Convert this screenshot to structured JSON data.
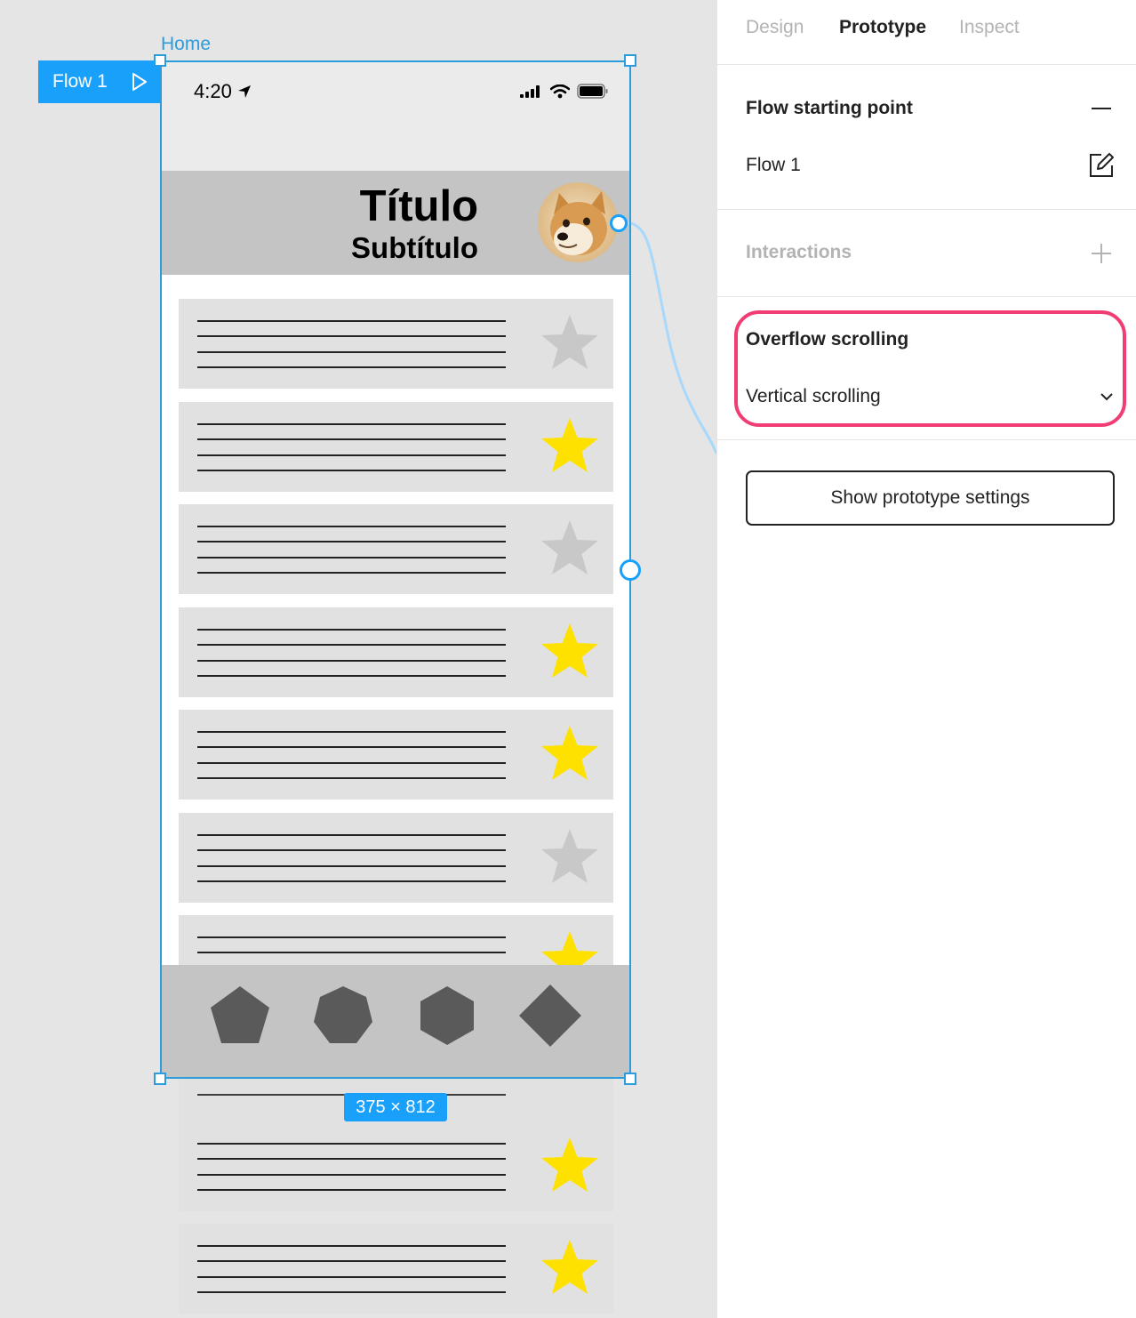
{
  "canvas": {
    "frame_name": "Home",
    "flow_tag_label": "Flow 1",
    "size_badge": "375 × 812",
    "phone": {
      "status_time": "4:20",
      "title": "Título",
      "subtitle": "Subtítulo",
      "cards": [
        {
          "starred": false
        },
        {
          "starred": true
        },
        {
          "starred": false
        },
        {
          "starred": true
        },
        {
          "starred": true
        },
        {
          "starred": false
        },
        {
          "starred": true
        }
      ],
      "overflow_cards": [
        {
          "starred": true
        },
        {
          "starred": true
        }
      ],
      "tabs": [
        "pentagon-icon",
        "heptagon-icon",
        "hexagon-icon",
        "diamond-icon"
      ]
    }
  },
  "panel": {
    "tabs": [
      {
        "label": "Design",
        "active": false
      },
      {
        "label": "Prototype",
        "active": true
      },
      {
        "label": "Inspect",
        "active": false
      }
    ],
    "flow_section": {
      "title": "Flow starting point",
      "flow_name": "Flow 1"
    },
    "interactions": {
      "title": "Interactions"
    },
    "overflow": {
      "title": "Overflow scrolling",
      "value": "Vertical scrolling"
    },
    "settings_button": "Show prototype settings"
  },
  "colors": {
    "selection": "#18a0fb",
    "highlight": "#f23c74",
    "star_on": "#ffe100",
    "star_off": "#c8c8c8",
    "tab_shape": "#5a5a5a"
  }
}
